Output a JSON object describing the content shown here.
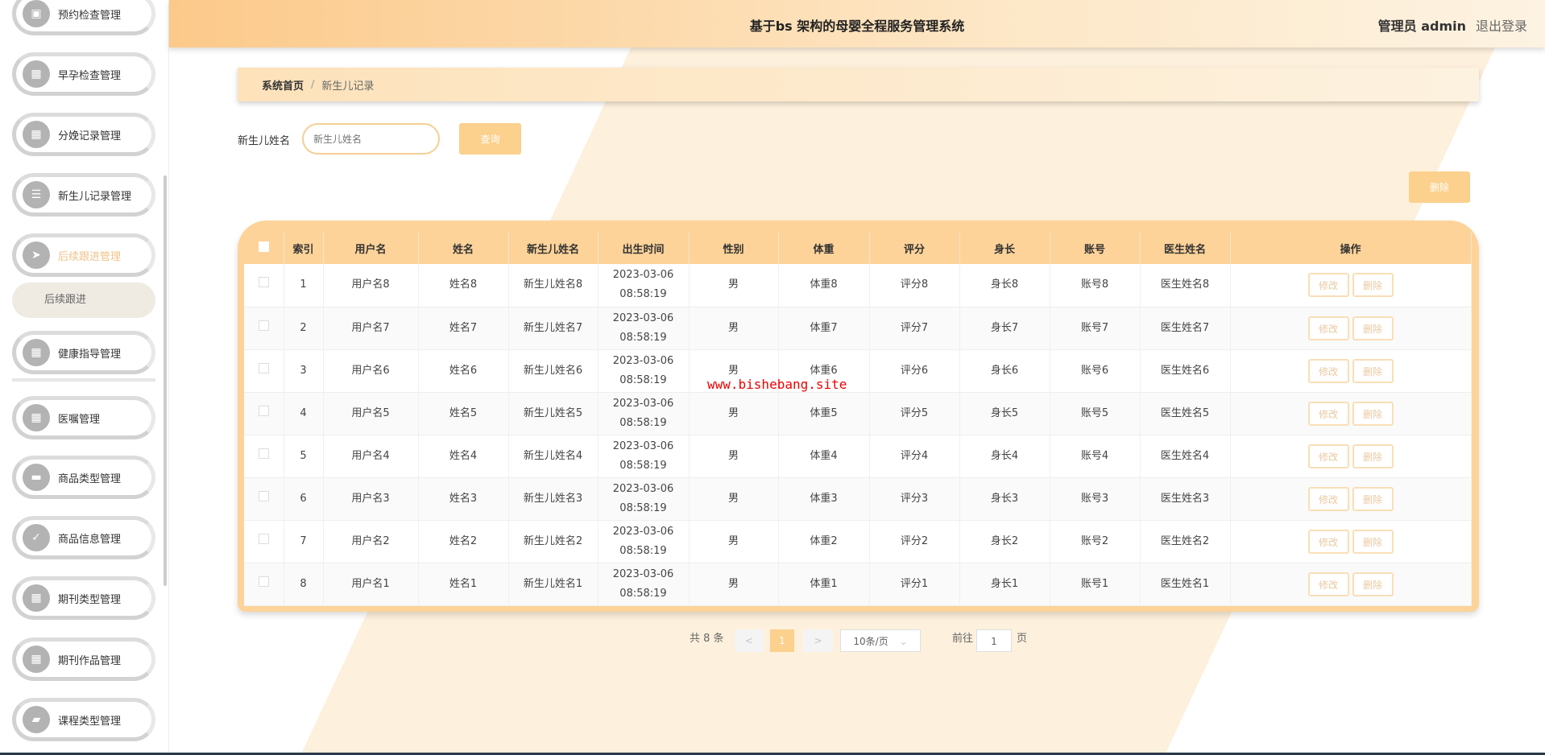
{
  "header": {
    "title": "基于bs 架构的母婴全程服务管理系统",
    "user": "管理员 admin",
    "logout": "退出登录"
  },
  "sidebar": {
    "items": [
      {
        "label": "预约检查管理",
        "icon": "clipboard-icon"
      },
      {
        "label": "早孕检查管理",
        "icon": "grid-icon"
      },
      {
        "label": "分娩记录管理",
        "icon": "grid-icon"
      },
      {
        "label": "新生儿记录管理",
        "icon": "list-icon"
      },
      {
        "label": "后续跟进管理",
        "icon": "paper-plane-icon",
        "active": true
      },
      {
        "label": "健康指导管理",
        "icon": "grid-icon"
      },
      {
        "label": "医嘱管理",
        "icon": "grid-icon"
      },
      {
        "label": "商品类型管理",
        "icon": "ticket-icon"
      },
      {
        "label": "商品信息管理",
        "icon": "clipboard-check-icon"
      },
      {
        "label": "期刊类型管理",
        "icon": "grid-icon"
      },
      {
        "label": "期刊作品管理",
        "icon": "grid-icon"
      },
      {
        "label": "课程类型管理",
        "icon": "wallet-icon"
      }
    ],
    "submenu": "后续跟进"
  },
  "breadcrumb": {
    "home": "系统首页",
    "sep": "/",
    "current": "新生儿记录"
  },
  "search": {
    "label": "新生儿姓名",
    "placeholder": "新生儿姓名",
    "button": "查询"
  },
  "toolbar": {
    "delete": "删除"
  },
  "table": {
    "columns": [
      "索引",
      "用户名",
      "姓名",
      "新生儿姓名",
      "出生时间",
      "性别",
      "体重",
      "评分",
      "身长",
      "账号",
      "医生姓名",
      "操作"
    ],
    "rows": [
      [
        "1",
        "用户名8",
        "姓名8",
        "新生儿姓名8",
        "2023-03-06 08:58:19",
        "男",
        "体重8",
        "评分8",
        "身长8",
        "账号8",
        "医生姓名8"
      ],
      [
        "2",
        "用户名7",
        "姓名7",
        "新生儿姓名7",
        "2023-03-06 08:58:19",
        "男",
        "体重7",
        "评分7",
        "身长7",
        "账号7",
        "医生姓名7"
      ],
      [
        "3",
        "用户名6",
        "姓名6",
        "新生儿姓名6",
        "2023-03-06 08:58:19",
        "男",
        "体重6",
        "评分6",
        "身长6",
        "账号6",
        "医生姓名6"
      ],
      [
        "4",
        "用户名5",
        "姓名5",
        "新生儿姓名5",
        "2023-03-06 08:58:19",
        "男",
        "体重5",
        "评分5",
        "身长5",
        "账号5",
        "医生姓名5"
      ],
      [
        "5",
        "用户名4",
        "姓名4",
        "新生儿姓名4",
        "2023-03-06 08:58:19",
        "男",
        "体重4",
        "评分4",
        "身长4",
        "账号4",
        "医生姓名4"
      ],
      [
        "6",
        "用户名3",
        "姓名3",
        "新生儿姓名3",
        "2023-03-06 08:58:19",
        "男",
        "体重3",
        "评分3",
        "身长3",
        "账号3",
        "医生姓名3"
      ],
      [
        "7",
        "用户名2",
        "姓名2",
        "新生儿姓名2",
        "2023-03-06 08:58:19",
        "男",
        "体重2",
        "评分2",
        "身长2",
        "账号2",
        "医生姓名2"
      ],
      [
        "8",
        "用户名1",
        "姓名1",
        "新生儿姓名1",
        "2023-03-06 08:58:19",
        "男",
        "体重1",
        "评分1",
        "身长1",
        "账号1",
        "医生姓名1"
      ]
    ],
    "edit": "修改",
    "delete": "删除"
  },
  "pagination": {
    "total": "共 8 条",
    "prev": "<",
    "page": "1",
    "next": ">",
    "size": "10条/页",
    "goto": "前往",
    "goto_value": "1",
    "page_suffix": "页"
  },
  "watermark": "www.bishebang.site"
}
